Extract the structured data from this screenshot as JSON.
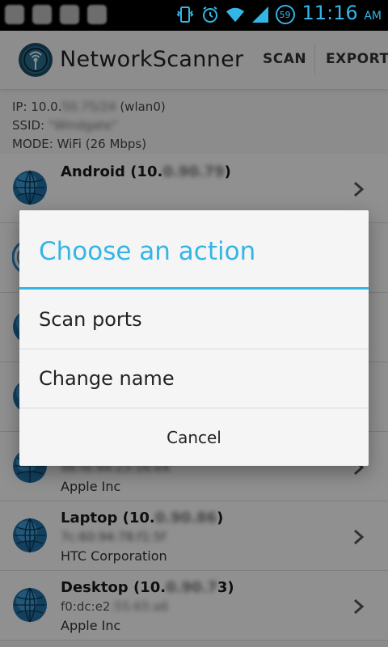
{
  "status_bar": {
    "time": "11:16",
    "ampm": "AM",
    "notification_count": "59"
  },
  "app_bar": {
    "title": "NetworkScanner",
    "scan_label": "SCAN",
    "export_label": "EXPORT"
  },
  "info": {
    "ip_prefix": "IP: 10.0.",
    "ip_hidden": "50.75/24",
    "ip_suffix": " (wlan0)",
    "ssid_prefix": "SSID: ",
    "ssid_hidden": "\"Windgate\"",
    "mode": "MODE: WiFi (26 Mbps)"
  },
  "devices": [
    {
      "name_prefix": "Android (10.",
      "name_hidden": "0.90.79",
      "name_suffix": ")",
      "mac_visible": "",
      "mac_hidden": "",
      "vendor": ""
    },
    {
      "name_prefix": "",
      "name_hidden": "",
      "name_suffix": "",
      "mac_visible": "",
      "mac_hidden": "98:fe:94:23:16:e4",
      "vendor": "Apple Inc"
    },
    {
      "name_prefix": "Laptop (10.",
      "name_hidden": "0.90.86",
      "name_suffix": ")",
      "mac_visible": "",
      "mac_hidden": "7c:60:94:78:f1:5f",
      "vendor": "HTC Corporation"
    },
    {
      "name_prefix": "Desktop (10.",
      "name_hidden": "0.90.7",
      "name_suffix": "3)",
      "mac_visible": "f0:dc:e2",
      "mac_hidden": ":55:65:a6",
      "vendor": "Apple Inc"
    }
  ],
  "dialog": {
    "title": "Choose an action",
    "options": [
      "Scan ports",
      "Change name"
    ],
    "cancel_label": "Cancel"
  },
  "colors": {
    "accent": "#33b5e5",
    "status_bar_bg": "#000000",
    "dialog_bg": "#f5f5f5"
  }
}
